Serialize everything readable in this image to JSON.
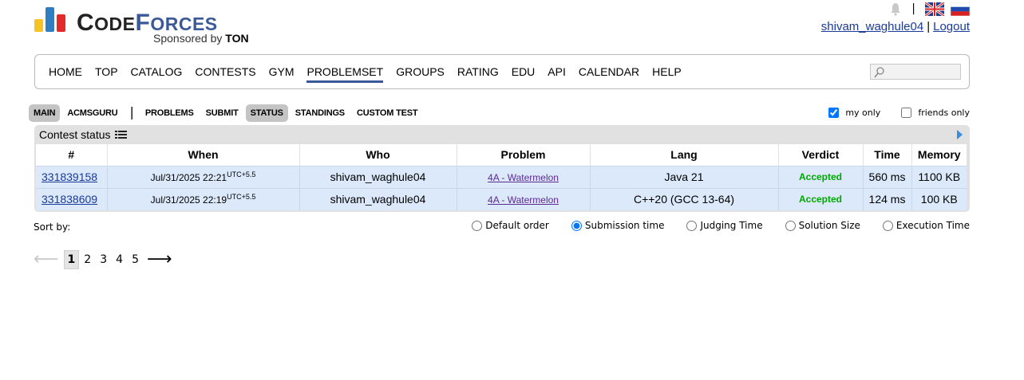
{
  "header": {
    "logo_main_a": "C",
    "logo_main_b": "ODE",
    "logo_main_c": "F",
    "logo_main_d": "ORCES",
    "sponsor_prefix": "Sponsored by ",
    "sponsor_brand": "TON",
    "separator": "|",
    "user": "shivam_waghule04",
    "user_sep": "|",
    "logout": "Logout"
  },
  "main_menu": {
    "items": [
      "HOME",
      "TOP",
      "CATALOG",
      "CONTESTS",
      "GYM",
      "PROBLEMSET",
      "GROUPS",
      "RATING",
      "EDU",
      "API",
      "CALENDAR",
      "HELP"
    ],
    "active": "PROBLEMSET",
    "search_value": ""
  },
  "second_menu": {
    "main": "MAIN",
    "acmsguru": "ACMSGURU",
    "separator": "|",
    "problems": "PROBLEMS",
    "submit": "SUBMIT",
    "status": "STATUS",
    "standings": "STANDINGS",
    "custom_test": "CUSTOM TEST"
  },
  "filters": {
    "my_only": "my only",
    "friends_only": "friends only",
    "my_only_checked": true,
    "friends_only_checked": false
  },
  "status": {
    "title": "Contest status",
    "columns": [
      "#",
      "When",
      "Who",
      "Problem",
      "Lang",
      "Verdict",
      "Time",
      "Memory"
    ],
    "rows": [
      {
        "id": "331839158",
        "when": "Jul/31/2025 22:21",
        "tz": "UTC+5.5",
        "who": "shivam_waghule04",
        "problem": "4A - Watermelon",
        "lang": "Java 21",
        "verdict": "Accepted",
        "time": "560 ms",
        "memory": "1100 KB"
      },
      {
        "id": "331838609",
        "when": "Jul/31/2025 22:19",
        "tz": "UTC+5.5",
        "who": "shivam_waghule04",
        "problem": "4A - Watermelon",
        "lang": "C++20 (GCC 13-64)",
        "verdict": "Accepted",
        "time": "124 ms",
        "memory": "100 KB"
      }
    ]
  },
  "sort": {
    "label": "Sort by:",
    "options": [
      "Default order",
      "Submission time",
      "Judging Time",
      "Solution Size",
      "Execution Time"
    ],
    "selected": "Submission time"
  },
  "pagination": {
    "prev": "⟵",
    "pages": [
      "1",
      "2",
      "3",
      "4",
      "5"
    ],
    "current": "1",
    "next": "⟶"
  },
  "colors": {
    "accent": "#3b5998",
    "accepted": "#00a900",
    "row_bg": "#dbe9fb"
  }
}
